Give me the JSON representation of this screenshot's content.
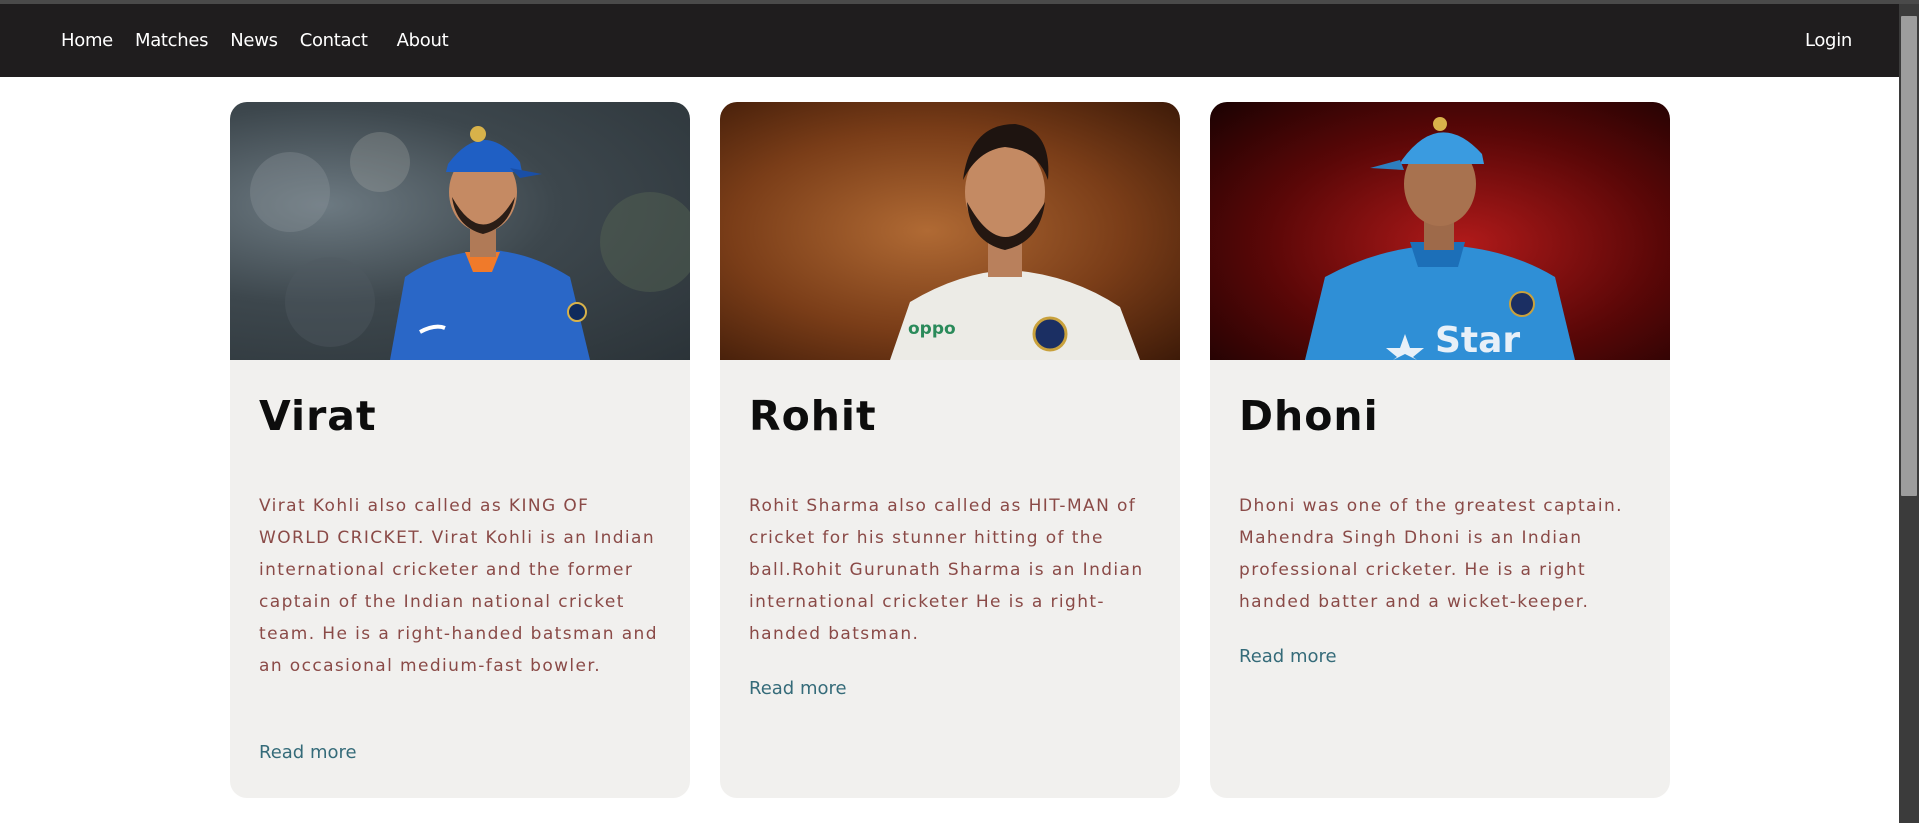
{
  "nav": {
    "links": [
      "Home",
      "Matches",
      "News",
      "Contact",
      "About"
    ],
    "login": "Login"
  },
  "cards": [
    {
      "name": "Virat",
      "description": "Virat Kohli also called as KING OF WORLD CRICKET. Virat Kohli is an Indian international cricketer and the former captain of the Indian national cricket team. He is a right-handed batsman and an occasional medium-fast bowler.",
      "read_more": "Read more",
      "photo_label": "portrait photo of Virat Kohli in blue India jersey"
    },
    {
      "name": "Rohit",
      "description": "Rohit Sharma also called as HIT-MAN of cricket for his stunner hitting of the ball.Rohit Gurunath Sharma is an Indian international cricketer He is a right-handed batsman.",
      "read_more": "Read more",
      "photo_label": "portrait photo of Rohit Sharma in white test jersey"
    },
    {
      "name": "Dhoni",
      "description": "Dhoni was one of the greatest captain. Mahendra Singh Dhoni is an Indian professional cricketer. He is a right handed batter and a wicket-keeper.",
      "read_more": "Read more",
      "photo_label": "portrait photo of MS Dhoni in blue India jersey and cap"
    }
  ],
  "photo_texts": {
    "oppo": "oppo",
    "star": "Star"
  },
  "colors": {
    "navbar": "#1f1d1e",
    "card_bg": "#f1f0ee",
    "desc_text": "#8a4a47",
    "link": "#356b79"
  }
}
